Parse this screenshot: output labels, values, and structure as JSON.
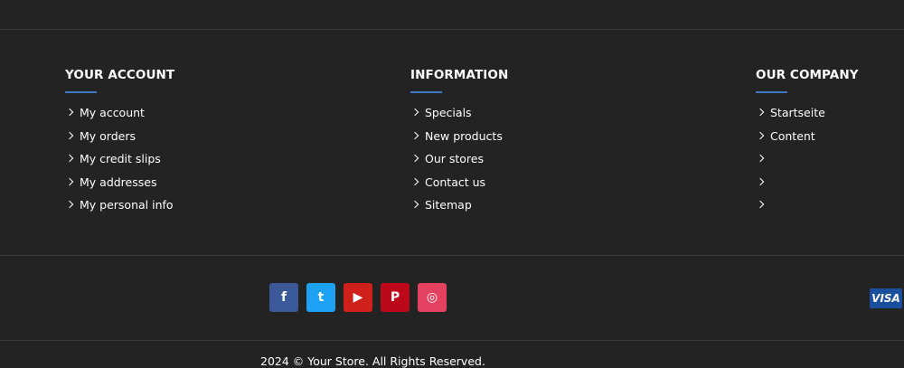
{
  "columns": [
    {
      "title": "YOUR ACCOUNT",
      "items": [
        "My account",
        "My orders",
        "My credit slips",
        "My addresses",
        "My personal info"
      ]
    },
    {
      "title": "INFORMATION",
      "items": [
        "Specials",
        "New products",
        "Our stores",
        "Contact us",
        "Sitemap"
      ]
    },
    {
      "title": "OUR COMPANY",
      "items": [
        "Startseite",
        "Content",
        "",
        "",
        ""
      ]
    }
  ],
  "social": [
    {
      "name": "facebook",
      "glyph": "f",
      "color": "#3b5998"
    },
    {
      "name": "twitter",
      "glyph": "t",
      "color": "#1da1f2"
    },
    {
      "name": "youtube",
      "glyph": "▶",
      "color": "#d0201b"
    },
    {
      "name": "pinterest",
      "glyph": "P",
      "color": "#bd081c"
    },
    {
      "name": "instagram",
      "glyph": "◎",
      "color": "#e4405f"
    }
  ],
  "payment": "VISA",
  "copyright": "2024 © Your Store. All Rights Reserved."
}
